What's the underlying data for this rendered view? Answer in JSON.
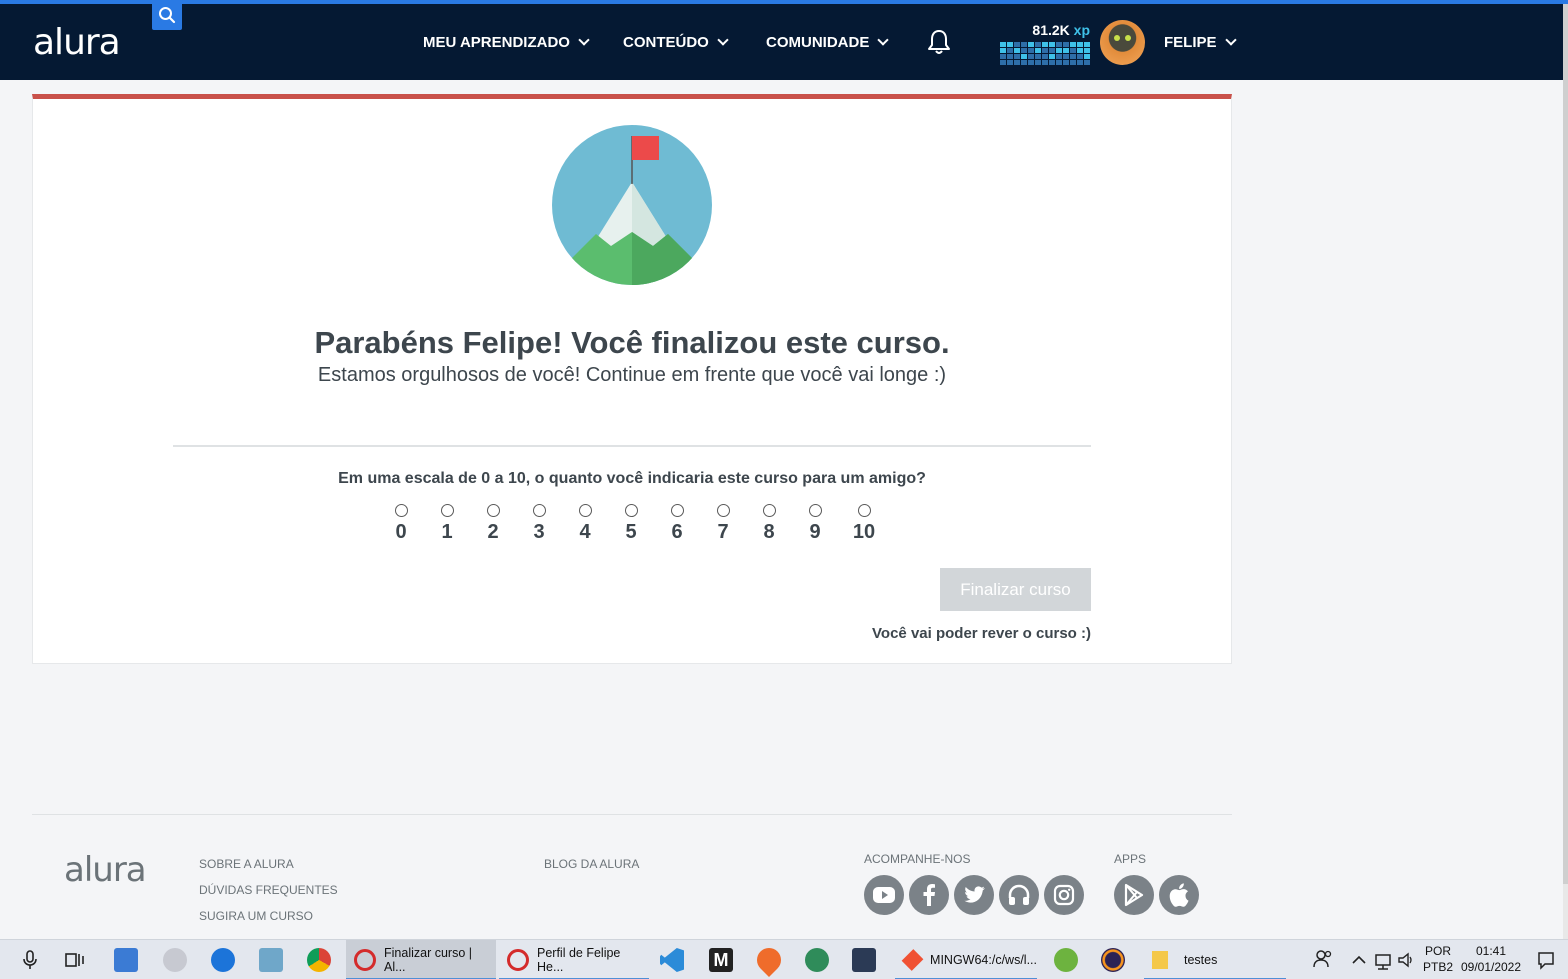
{
  "header": {
    "logo": "alura",
    "nav": [
      {
        "label": "MEU APRENDIZADO"
      },
      {
        "label": "CONTEÚDO"
      },
      {
        "label": "COMUNIDADE"
      }
    ],
    "xp_value": "81.2K",
    "xp_unit": "xp",
    "user_name": "FELIPE"
  },
  "main": {
    "title": "Parabéns Felipe! Você finalizou este curso.",
    "subtitle": "Estamos orgulhosos de você! Continue em frente que você vai longe :)",
    "question": "Em uma escala de 0 a 10, o quanto você indicaria este curso para um amigo?",
    "scale": [
      "0",
      "1",
      "2",
      "3",
      "4",
      "5",
      "6",
      "7",
      "8",
      "9",
      "10"
    ],
    "finish_button": "Finalizar curso",
    "rever_text": "Você vai poder rever o curso :)"
  },
  "footer": {
    "logo": "alura",
    "links_col1": [
      "SOBRE A ALURA",
      "DÚVIDAS FREQUENTES",
      "SUGIRA UM CURSO"
    ],
    "links_col2": [
      "BLOG DA ALURA"
    ],
    "social_heading": "ACOMPANHE-NOS",
    "apps_heading": "APPS"
  },
  "taskbar": {
    "windows": [
      {
        "label": "Finalizar curso | Al...",
        "active": true
      },
      {
        "label": "Perfil de Felipe He...",
        "active": false
      },
      {
        "label": "MINGW64:/c/ws/l...",
        "active": false
      },
      {
        "label": "testes",
        "active": false
      }
    ],
    "lang_top": "POR",
    "lang_bottom": "PTB2",
    "time": "01:41",
    "date": "09/01/2022"
  },
  "colors": {
    "header_bg": "#051933",
    "accent_blue": "#2a7ae4",
    "card_top_border": "#c9514a",
    "xp_accent": "#3fc1e8"
  }
}
